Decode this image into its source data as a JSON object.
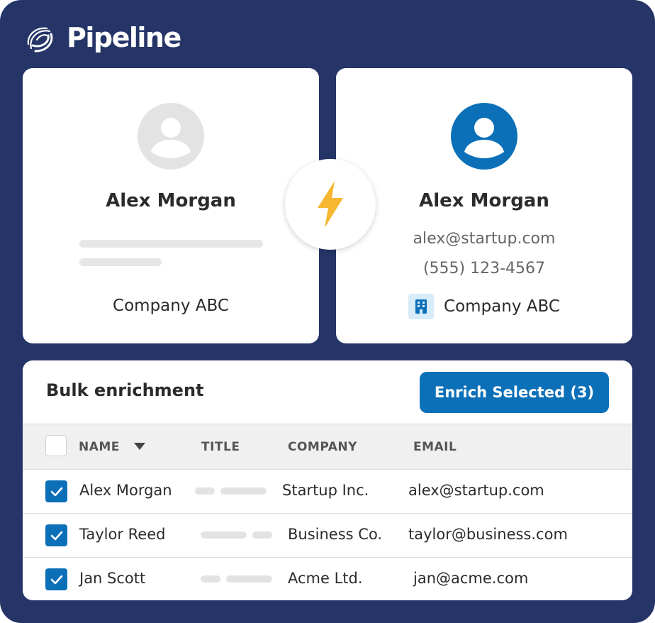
{
  "app": {
    "name": "Pipeline"
  },
  "before_card": {
    "name": "Alex Morgan",
    "company": "Company ABC"
  },
  "after_card": {
    "name": "Alex Morgan",
    "email": "alex@startup.com",
    "phone": "(555) 123-4567",
    "company": "Company ABC"
  },
  "colors": {
    "frame_bg": "#263567",
    "accent_blue": "#0c70b9",
    "bolt_yellow": "#f7b731",
    "placeholder_gray": "#e6e6e6"
  },
  "icons": [
    "pipeline-logo-icon",
    "user-placeholder-icon",
    "user-icon",
    "lightning-bolt-icon",
    "building-icon",
    "caret-down-icon",
    "checkmark-icon"
  ],
  "bulk": {
    "title": "Bulk enrichment",
    "enrich_button": "Enrich Selected (3)",
    "columns": {
      "name": "NAME",
      "title": "TITLE",
      "company": "COMPANY",
      "email": "EMAIL"
    },
    "rows": [
      {
        "checked": true,
        "name": "Alex Morgan",
        "company": "Startup Inc.",
        "email": "alex@startup.com"
      },
      {
        "checked": true,
        "name": "Taylor Reed",
        "company": "Business Co.",
        "email": "taylor@business.com"
      },
      {
        "checked": true,
        "name": "Jan Scott",
        "company": "Acme Ltd.",
        "email": "jan@acme.com"
      }
    ]
  }
}
